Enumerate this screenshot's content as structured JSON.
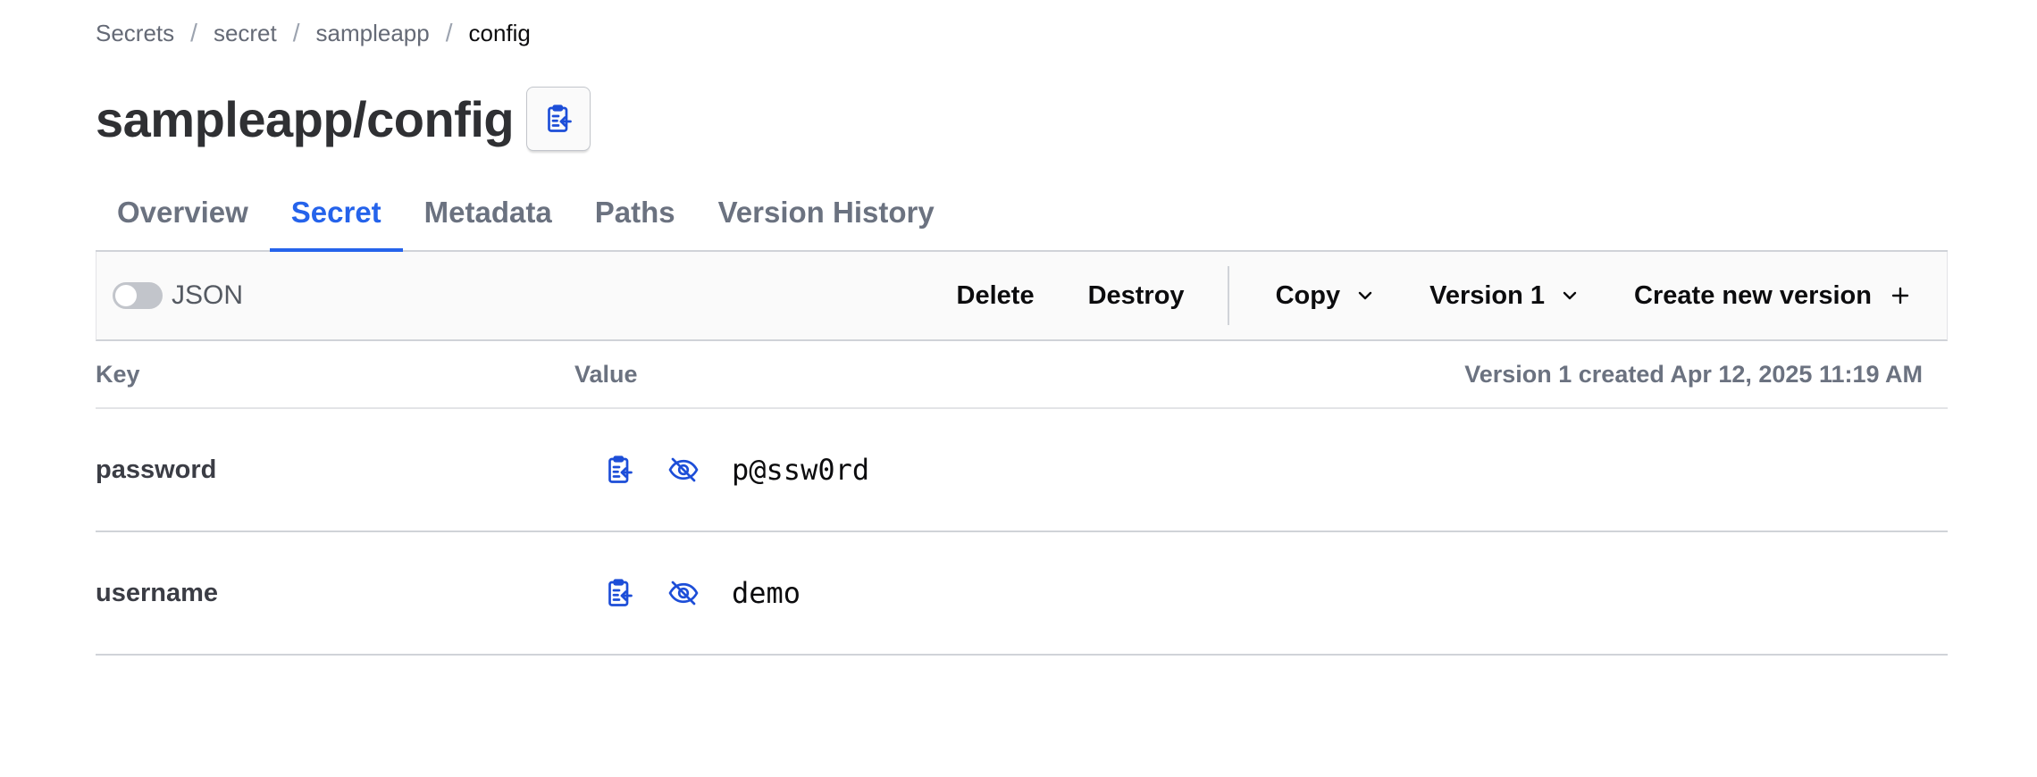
{
  "breadcrumb": {
    "items": [
      "Secrets",
      "secret",
      "sampleapp"
    ],
    "current": "config",
    "separator": "/"
  },
  "title": "sampleapp/config",
  "tabs": [
    {
      "label": "Overview",
      "active": false
    },
    {
      "label": "Secret",
      "active": true
    },
    {
      "label": "Metadata",
      "active": false
    },
    {
      "label": "Paths",
      "active": false
    },
    {
      "label": "Version History",
      "active": false
    }
  ],
  "toolbar": {
    "json_label": "JSON",
    "json_enabled": false,
    "delete_label": "Delete",
    "destroy_label": "Destroy",
    "copy_label": "Copy",
    "version_label": "Version 1",
    "create_label": "Create new version"
  },
  "table": {
    "key_header": "Key",
    "value_header": "Value",
    "version_info": "Version 1 created Apr 12, 2025 11:19 AM",
    "rows": [
      {
        "key": "password",
        "value": "p@ssw0rd"
      },
      {
        "key": "username",
        "value": "demo"
      }
    ]
  },
  "colors": {
    "accent": "#2563eb",
    "icon": "#1d4ed8",
    "text_muted": "#6b7280"
  }
}
